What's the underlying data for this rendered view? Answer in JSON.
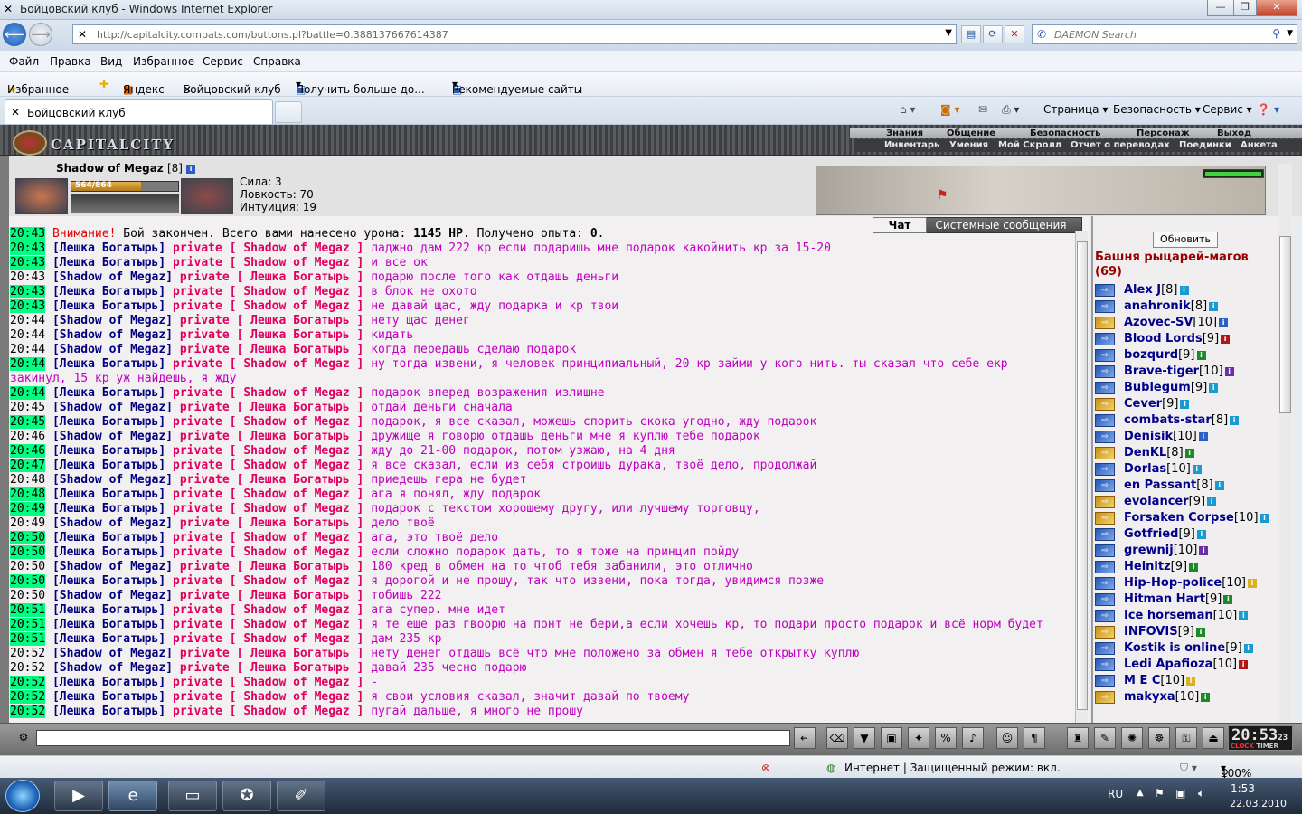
{
  "window": {
    "title": "Бойцовский клуб - Windows Internet Explorer"
  },
  "browser": {
    "url": "http://capitalcity.combats.com/buttons.pl?battle=0.388137667614387",
    "search_placeholder": "DAEMON Search",
    "menu": [
      "Файл",
      "Правка",
      "Вид",
      "Избранное",
      "Сервис",
      "Справка"
    ],
    "favorites": [
      "Избранное",
      "Яндекс",
      "Бойцовский клуб",
      "Получить больше до...",
      "Рекомендуемые сайты"
    ],
    "tab_title": "Бойцовский клуб",
    "commands": [
      "Страница",
      "Безопасность",
      "Сервис"
    ]
  },
  "game": {
    "logo": "CAPITALCITY",
    "nav_top": [
      "Знания",
      "Общение",
      "Безопасность",
      "Персонаж",
      "Выход"
    ],
    "nav_bottom": [
      "Инвентарь",
      "Умения",
      "Мой Скролл",
      "Отчет о переводах",
      "Поединки",
      "Анкета"
    ],
    "character": {
      "name": "Shadow of Megaz",
      "level": "[8]",
      "hp_text": "564/864",
      "hp_fraction": 0.653,
      "stats": [
        "Сила: 3",
        "Ловкость: 70",
        "Интуиция: 19"
      ]
    },
    "chat_tabs": {
      "chat": "Чат",
      "system": "Системные сообщения"
    },
    "notice": {
      "time": "20:43",
      "label": "Внимание!",
      "text_a": " Бой закончен. Всего вами нанесено урона: ",
      "damage": "1145 HP",
      "text_b": ". Получено опыта: ",
      "exp": "0",
      "end": "."
    },
    "private_label": "private",
    "messages": [
      {
        "t": "20:43",
        "hl": true,
        "from": "Лешка Богатырь",
        "to": "Shadow of Megaz",
        "msg": "ладжно дам 222 кр если подаришь мне подарок какойнить кр за 15-20"
      },
      {
        "t": "20:43",
        "hl": true,
        "from": "Лешка Богатырь",
        "to": "Shadow of Megaz",
        "msg": "и все ок"
      },
      {
        "t": "20:43",
        "hl": false,
        "from": "Shadow of Megaz",
        "to": "Лешка Богатырь",
        "msg": "подарю после того как отдашь деньги"
      },
      {
        "t": "20:43",
        "hl": true,
        "from": "Лешка Богатырь",
        "to": "Shadow of Megaz",
        "msg": "в блок не охото"
      },
      {
        "t": "20:43",
        "hl": true,
        "from": "Лешка Богатырь",
        "to": "Shadow of Megaz",
        "msg": "не давай щас, жду подарка и кр твои"
      },
      {
        "t": "20:44",
        "hl": false,
        "from": "Shadow of Megaz",
        "to": "Лешка Богатырь",
        "msg": "нету щас денег"
      },
      {
        "t": "20:44",
        "hl": false,
        "from": "Shadow of Megaz",
        "to": "Лешка Богатырь",
        "msg": "кидать"
      },
      {
        "t": "20:44",
        "hl": false,
        "from": "Shadow of Megaz",
        "to": "Лешка Богатырь",
        "msg": "когда передашь сделаю подарок"
      },
      {
        "t": "20:44",
        "hl": true,
        "from": "Лешка Богатырь",
        "to": "Shadow of Megaz",
        "msg": "ну тогда извени, я человек принципиальный, 20 кр займи у кого нить. ты сказал что себе екр закинул, 15 кр уж найдешь, я жду"
      },
      {
        "t": "20:44",
        "hl": true,
        "from": "Лешка Богатырь",
        "to": "Shadow of Megaz",
        "msg": "подарок вперед возражения излишне"
      },
      {
        "t": "20:45",
        "hl": false,
        "from": "Shadow of Megaz",
        "to": "Лешка Богатырь",
        "msg": "отдай деньги сначала"
      },
      {
        "t": "20:45",
        "hl": true,
        "from": "Лешка Богатырь",
        "to": "Shadow of Megaz",
        "msg": "подарок, я все сказал, можешь спорить скока угодно, жду подарок"
      },
      {
        "t": "20:46",
        "hl": false,
        "from": "Shadow of Megaz",
        "to": "Лешка Богатырь",
        "msg": "дружище я говорю отдашь деньги мне я куплю тебе подарок"
      },
      {
        "t": "20:46",
        "hl": true,
        "from": "Лешка Богатырь",
        "to": "Shadow of Megaz",
        "msg": "жду до 21-00 подарок, потом узжаю, на 4 дня"
      },
      {
        "t": "20:47",
        "hl": true,
        "from": "Лешка Богатырь",
        "to": "Shadow of Megaz",
        "msg": "я все сказал, если из себя строишь дурака, твоё дело, продолжай"
      },
      {
        "t": "20:48",
        "hl": false,
        "from": "Shadow of Megaz",
        "to": "Лешка Богатырь",
        "msg": "приедешь гера не будет"
      },
      {
        "t": "20:48",
        "hl": true,
        "from": "Лешка Богатырь",
        "to": "Shadow of Megaz",
        "msg": "ага я понял, жду подарок"
      },
      {
        "t": "20:49",
        "hl": true,
        "from": "Лешка Богатырь",
        "to": "Shadow of Megaz",
        "msg": "подарок с текстом хорошему другу, или лучшему торговцу,"
      },
      {
        "t": "20:49",
        "hl": false,
        "from": "Shadow of Megaz",
        "to": "Лешка Богатырь",
        "msg": "дело твоё"
      },
      {
        "t": "20:50",
        "hl": true,
        "from": "Лешка Богатырь",
        "to": "Shadow of Megaz",
        "msg": "ага, это твоё дело"
      },
      {
        "t": "20:50",
        "hl": true,
        "from": "Лешка Богатырь",
        "to": "Shadow of Megaz",
        "msg": "если сложно подарок дать, то я тоже на принцип пойду"
      },
      {
        "t": "20:50",
        "hl": false,
        "from": "Shadow of Megaz",
        "to": "Лешка Богатырь",
        "msg": "180 кред в обмен на то чтоб тебя забанили, это отлично"
      },
      {
        "t": "20:50",
        "hl": true,
        "from": "Лешка Богатырь",
        "to": "Shadow of Megaz",
        "msg": "я дорогой и не прошу, так что извени, пока тогда, увидимся позже"
      },
      {
        "t": "20:50",
        "hl": false,
        "from": "Shadow of Megaz",
        "to": "Лешка Богатырь",
        "msg": "тобишь 222"
      },
      {
        "t": "20:51",
        "hl": true,
        "from": "Лешка Богатырь",
        "to": "Shadow of Megaz",
        "msg": "ага супер. мне идет"
      },
      {
        "t": "20:51",
        "hl": true,
        "from": "Лешка Богатырь",
        "to": "Shadow of Megaz",
        "msg": "я те еще раз гвоорю на понт не бери,а если хочешь кр, то подари просто подарок и всё норм будет"
      },
      {
        "t": "20:51",
        "hl": true,
        "from": "Лешка Богатырь",
        "to": "Shadow of Megaz",
        "msg": "дам 235 кр"
      },
      {
        "t": "20:52",
        "hl": false,
        "from": "Shadow of Megaz",
        "to": "Лешка Богатырь",
        "msg": "нету денег отдашь всё что мне положено за обмен я тебе открытку куплю"
      },
      {
        "t": "20:52",
        "hl": false,
        "from": "Shadow of Megaz",
        "to": "Лешка Богатырь",
        "msg": "давай 235 чесно подарю"
      },
      {
        "t": "20:52",
        "hl": true,
        "from": "Лешка Богатырь",
        "to": "Shadow of Megaz",
        "msg": "-"
      },
      {
        "t": "20:52",
        "hl": true,
        "from": "Лешка Богатырь",
        "to": "Shadow of Megaz",
        "msg": "я свои условия сказал, значит давай по твоему"
      },
      {
        "t": "20:52",
        "hl": true,
        "from": "Лешка Богатырь",
        "to": "Shadow of Megaz",
        "msg": "пугай дальше, я много не прошу"
      }
    ],
    "room": {
      "refresh_label": "Обновить",
      "name": "Башня рыцарей-магов",
      "count": "(69)",
      "users": [
        {
          "name": "Alex J",
          "lvl": "[8]",
          "side": "blue",
          "badge": "#1a9ad0"
        },
        {
          "name": "anahronik",
          "lvl": "[8]",
          "side": "blue",
          "badge": "#1a9ad0"
        },
        {
          "name": "Azovec-SV",
          "lvl": "[10]",
          "side": "war",
          "badge": "#2b5ec7"
        },
        {
          "name": "Blood Lords",
          "lvl": "[9]",
          "side": "blue",
          "badge": "#b01818"
        },
        {
          "name": "bozqurd",
          "lvl": "[9]",
          "side": "blue",
          "badge": "#1a8a2a"
        },
        {
          "name": "Brave-tiger",
          "lvl": "[10]",
          "side": "blue",
          "badge": "#6b2fa8"
        },
        {
          "name": "Bublegum",
          "lvl": "[9]",
          "side": "blue",
          "badge": "#1a9ad0"
        },
        {
          "name": "Cever",
          "lvl": "[9]",
          "side": "war",
          "badge": "#1a9ad0"
        },
        {
          "name": "combats-star",
          "lvl": "[8]",
          "side": "blue",
          "badge": "#1a9ad0"
        },
        {
          "name": "Denisik",
          "lvl": "[10]",
          "side": "blue",
          "badge": "#2b5ec7"
        },
        {
          "name": "DenKL",
          "lvl": "[8]",
          "side": "war",
          "badge": "#1a8a2a"
        },
        {
          "name": "Dorlas",
          "lvl": "[10]",
          "side": "blue",
          "badge": "#1a9ad0"
        },
        {
          "name": "en Passant",
          "lvl": "[8]",
          "side": "blue",
          "badge": "#1a9ad0"
        },
        {
          "name": "evolancer",
          "lvl": "[9]",
          "side": "war",
          "badge": "#1a9ad0"
        },
        {
          "name": "Forsaken Corpse",
          "lvl": "[10]",
          "side": "war",
          "badge": "#1a9ad0"
        },
        {
          "name": "Gotfried",
          "lvl": "[9]",
          "side": "blue",
          "badge": "#1a9ad0"
        },
        {
          "name": "grewnij",
          "lvl": "[10]",
          "side": "blue",
          "badge": "#6b2fa8"
        },
        {
          "name": "Heinitz",
          "lvl": "[9]",
          "side": "blue",
          "badge": "#1a8a2a"
        },
        {
          "name": "Hip-Hop-police",
          "lvl": "[10]",
          "side": "blue",
          "badge": "#d8b020"
        },
        {
          "name": "Hitman Hart",
          "lvl": "[9]",
          "side": "blue",
          "badge": "#1a8a2a"
        },
        {
          "name": "Ice horseman",
          "lvl": "[10]",
          "side": "blue",
          "badge": "#1a9ad0"
        },
        {
          "name": "INFOVIS",
          "lvl": "[9]",
          "side": "war",
          "badge": "#1a8a2a"
        },
        {
          "name": "Kostik is online",
          "lvl": "[9]",
          "side": "blue",
          "badge": "#1a9ad0"
        },
        {
          "name": "Ledi Apafioza",
          "lvl": "[10]",
          "side": "blue",
          "badge": "#b01818"
        },
        {
          "name": "M E C",
          "lvl": "[10]",
          "side": "blue",
          "badge": "#d8b020"
        },
        {
          "name": "makyxa",
          "lvl": "[10]",
          "side": "war",
          "badge": "#1a8a2a"
        }
      ]
    },
    "clock": {
      "time": "20:53",
      "sec": "23",
      "label_a": "CLOCK",
      "label_b": "TIMER"
    }
  },
  "statusbar": {
    "zone": "Интернет | Защищенный режим: вкл.",
    "zoom": "100%"
  },
  "taskbar": {
    "lang": "RU",
    "time": "1:53",
    "date": "22.03.2010"
  }
}
